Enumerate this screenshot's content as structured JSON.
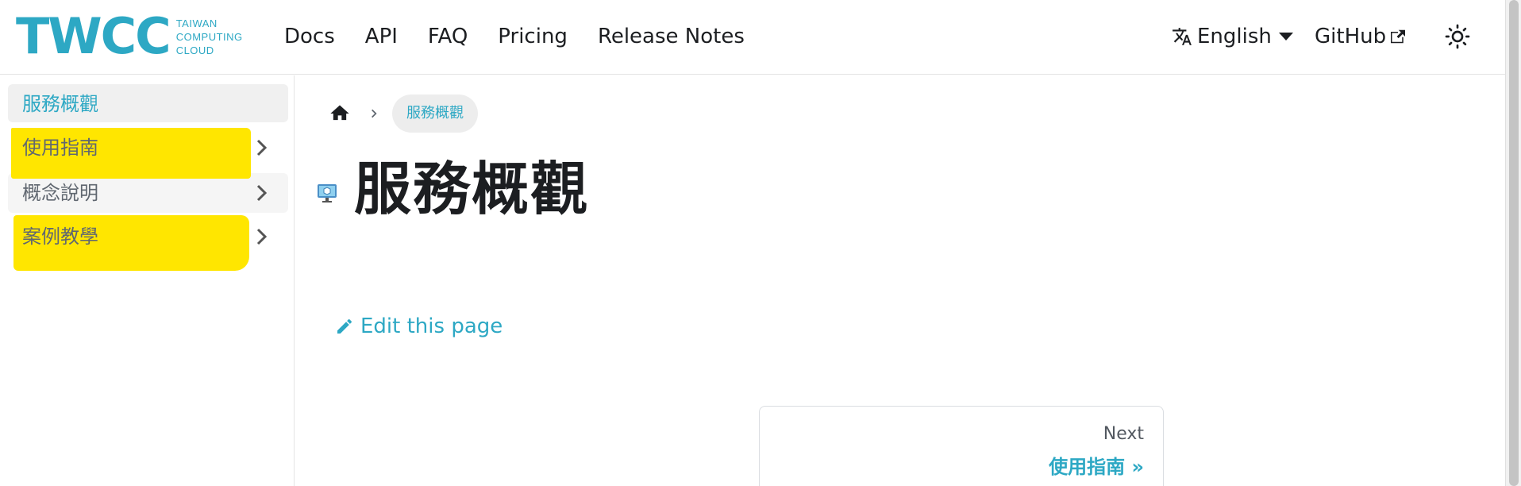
{
  "brand": {
    "mark": "TWCC",
    "line1": "TAIWAN",
    "line2": "COMPUTING",
    "line3": "CLOUD",
    "color": "#2da8c4"
  },
  "nav": {
    "links": [
      "Docs",
      "API",
      "FAQ",
      "Pricing",
      "Release Notes"
    ],
    "language": "English",
    "github": "GitHub",
    "icons": [
      "translate-icon",
      "caret-down-icon",
      "external-link-icon",
      "sun-icon"
    ]
  },
  "sidebar": {
    "items": [
      {
        "label": "服務概觀",
        "active": true
      },
      {
        "label": "使用指南",
        "active": false,
        "highlighted": true
      },
      {
        "label": "概念說明",
        "active": false
      },
      {
        "label": "案例教學",
        "active": false,
        "highlighted": true
      }
    ],
    "highlight_color": "#ffe600"
  },
  "main": {
    "breadcrumb": {
      "current": "服務概觀"
    },
    "title": "服務概觀",
    "edit_label": "Edit this page",
    "pager": {
      "sublabel": "Next",
      "label": "使用指南 »"
    }
  }
}
